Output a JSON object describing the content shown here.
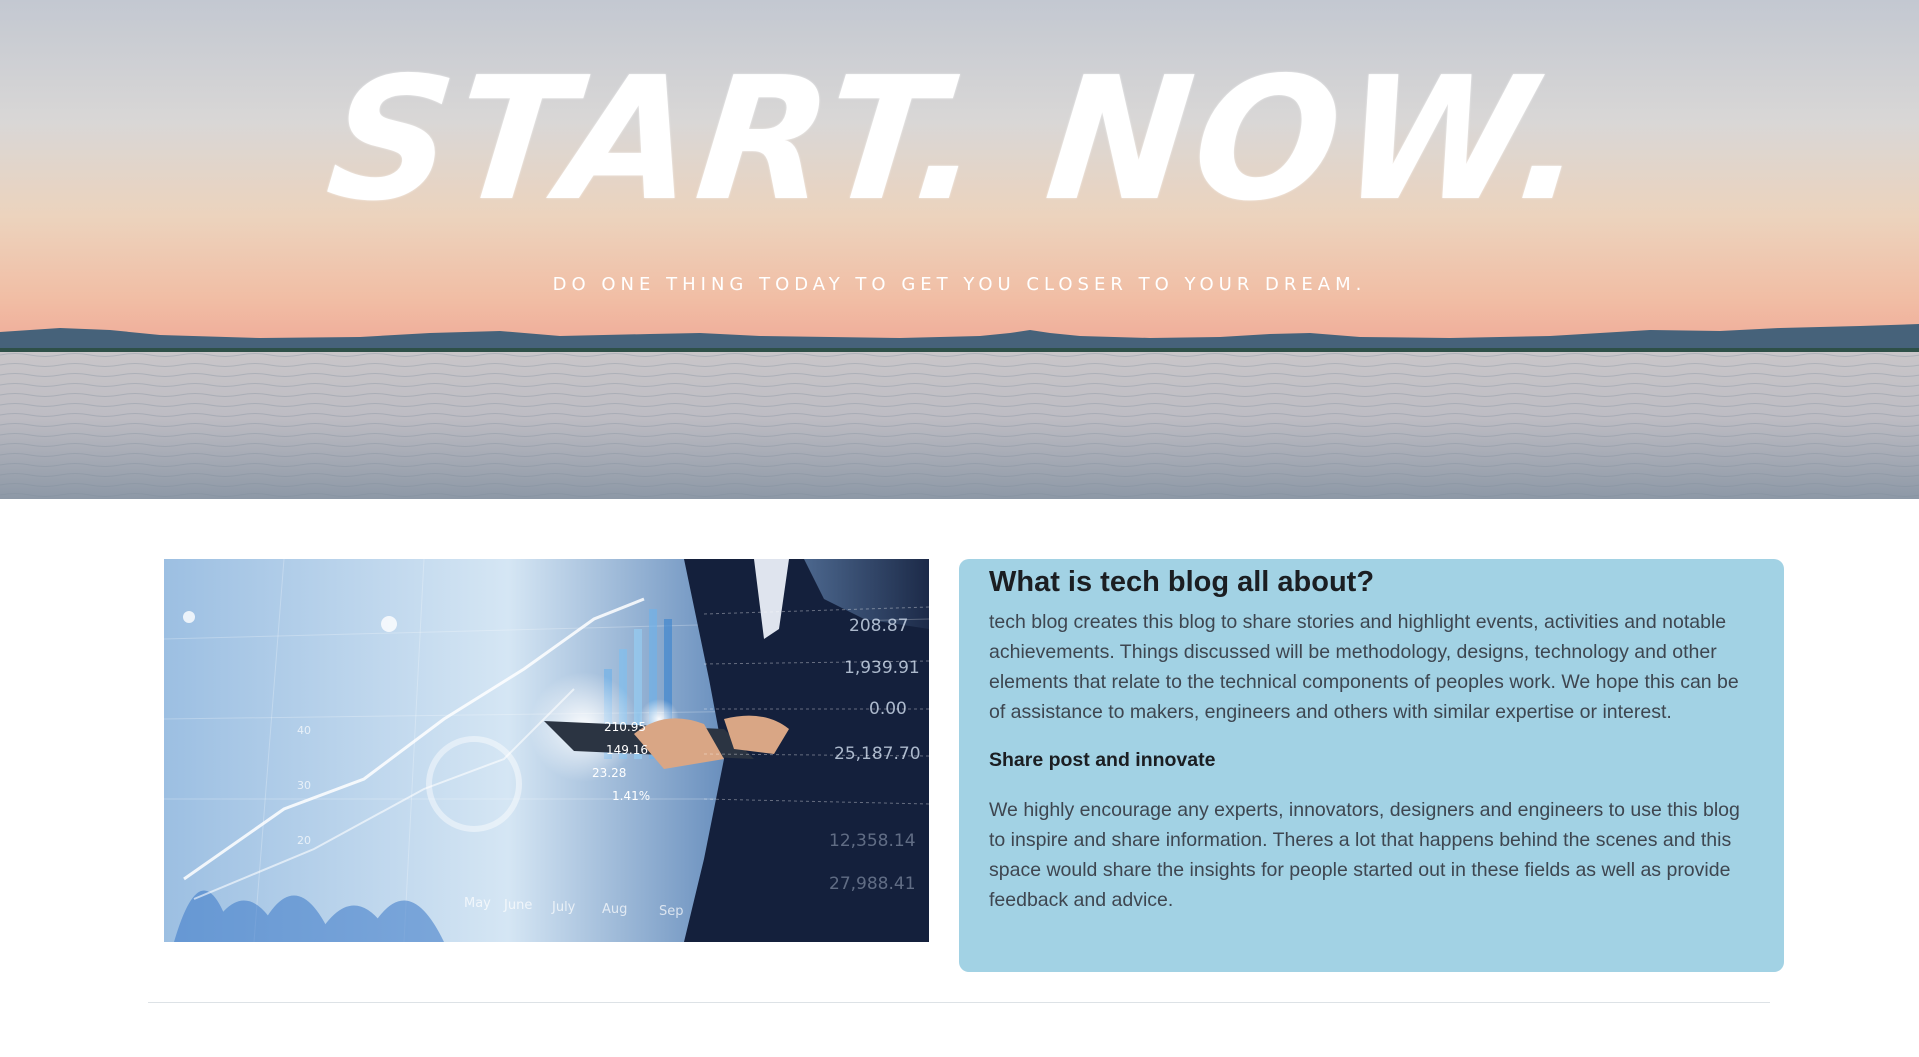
{
  "hero": {
    "title": "START. NOW.",
    "subtitle": "DO ONE THING TODAY TO GET YOU CLOSER TO YOUR DREAM."
  },
  "feature_image": {
    "tablet_values": [
      "210.95",
      "149.16",
      "23.28",
      "1.41%"
    ],
    "panel_values": [
      "208.87",
      "1,939.91",
      "0.00",
      "25,187.70",
      "12,358.14",
      "27,988.41"
    ],
    "month_labels": [
      "May",
      "June",
      "July",
      "Aug",
      "Sep"
    ],
    "axis_values": [
      "20",
      "30",
      "40"
    ]
  },
  "info": {
    "title": "What is tech blog all about?",
    "paragraph1": "tech blog creates this blog to share stories and highlight events, activities and notable achievements. Things discussed will be methodology, designs, technology and other elements that relate to the technical components of peoples work. We hope this can be of assistance to makers, engineers and others with similar expertise or interest.",
    "subheading": "Share post and innovate",
    "paragraph2": "We highly encourage any experts, innovators, designers and engineers to use this blog to inspire and share information. Theres a lot that happens behind the scenes and this space would share the insights for people started out in these fields as well as provide feedback and advice."
  },
  "colors": {
    "card_background": "#a2d2e4",
    "heading_text": "#1b1e22",
    "body_text": "#3e4650"
  }
}
